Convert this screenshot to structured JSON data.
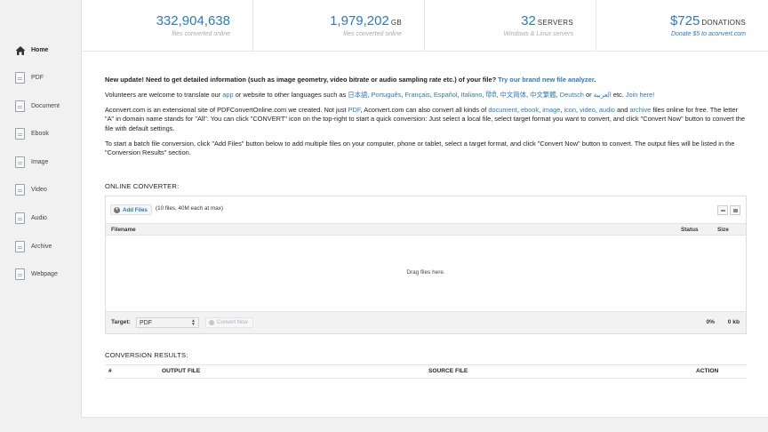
{
  "sidebar": {
    "items": [
      {
        "label": "Home",
        "icon": "home-icon"
      },
      {
        "label": "PDF",
        "icon": "pdf-icon"
      },
      {
        "label": "Document",
        "icon": "document-icon"
      },
      {
        "label": "Ebook",
        "icon": "ebook-icon"
      },
      {
        "label": "Image",
        "icon": "image-icon"
      },
      {
        "label": "Video",
        "icon": "video-icon"
      },
      {
        "label": "Audio",
        "icon": "audio-icon"
      },
      {
        "label": "Archive",
        "icon": "archive-icon"
      },
      {
        "label": "Webpage",
        "icon": "webpage-icon"
      }
    ]
  },
  "stats": [
    {
      "value": "332,904,638",
      "unit": "",
      "caption": "files converted online"
    },
    {
      "value": "1,979,202",
      "unit": "GB",
      "caption": "files converted online"
    },
    {
      "value": "32",
      "unit": "SERVERS",
      "caption": "Windows & Linux servers"
    },
    {
      "value": "$725",
      "unit": "DONATIONS",
      "caption": "Donate $5 to aconvert.com"
    }
  ],
  "notice": {
    "text": "New update! Need to get detailed information (such as image geometry, video bitrate or audio sampling rate etc.) of your file?",
    "link": "Try our brand new file analyzer",
    "end": "."
  },
  "translate": {
    "t1": "Volunteers are welcome to translate our",
    "app": "app",
    "t2": "or website to other languages such as",
    "langs": [
      "日本語",
      "Português",
      "Français",
      "Español",
      "Italiano",
      "हिंदी",
      "中文简体",
      "中文繁體",
      "Deutsch",
      "العربية"
    ],
    "or": "or",
    "etc": "etc.",
    "join": "Join here!"
  },
  "about": {
    "t1": "Aconvert.com is an extensional site of PDFConvertOnline.com we created. Not just",
    "pdf": "PDF",
    "t2": ", Aconvert.com can also convert all kinds of",
    "document": "document",
    "ebook": "ebook",
    "image": "image",
    "icon": "icon",
    "video": "video",
    "audio": "audio",
    "and": "and",
    "archive": "archive",
    "t3": "files online for free. The letter \"A\" in domain name stands for \"All\". You can click \"CONVERT\" icon on the top-right to start a quick conversion: Just select a local file, select target format you want to convert, and click \"Convert Now\" button to convert the file with default settings."
  },
  "batch": {
    "text": "To start a batch file conversion, click \"Add Files\" button below to add multiple files on your computer, phone or tablet, select a target format, and click \"Convert Now\" button to convert. The output files will be listed in the \"Conversion Results\" section."
  },
  "converter": {
    "title": "ONLINE CONVERTER:",
    "add_files": "Add Files",
    "limit": "(10 files, 40M each at max)",
    "col_filename": "Filename",
    "col_status": "Status",
    "col_size": "Size",
    "drop_text": "Drag files here.",
    "target_label": "Target:",
    "target_value": "PDF",
    "convert_now": "Convert Now",
    "progress": "0%",
    "total_size": "0 kb"
  },
  "results": {
    "title": "CONVERSION RESULTS:",
    "col_num": "#",
    "col_output": "OUTPUT FILE",
    "col_source": "SOURCE FILE",
    "col_action": "ACTION"
  },
  "colors": {
    "accent": "#2a7ac1",
    "sidebar_bg": "#f1f1f1"
  }
}
